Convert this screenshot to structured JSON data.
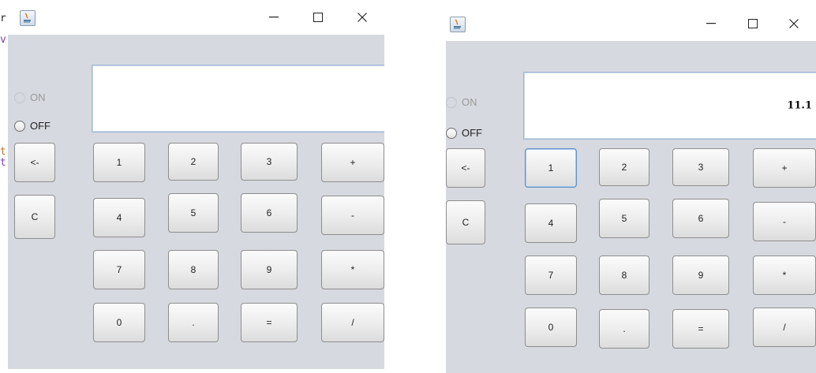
{
  "left_strip": {
    "chars": [
      "r",
      "v",
      "t",
      "t"
    ]
  },
  "window_left": {
    "radio_on": {
      "label": "ON",
      "selected": false,
      "enabled": false
    },
    "radio_off": {
      "label": "OFF",
      "selected": false,
      "enabled": true
    },
    "display_value": "",
    "side_keys": [
      "<-",
      "C"
    ],
    "keys": [
      [
        "1",
        "2",
        "3",
        "+"
      ],
      [
        "4",
        "5",
        "6",
        "-"
      ],
      [
        "7",
        "8",
        "9",
        "*"
      ],
      [
        "0",
        ".",
        "=",
        "/"
      ]
    ]
  },
  "window_right": {
    "radio_on": {
      "label": "ON",
      "selected": false,
      "enabled": false
    },
    "radio_off": {
      "label": "OFF",
      "selected": false,
      "enabled": true
    },
    "display_value": "11.1",
    "side_keys": [
      "<-",
      "C"
    ],
    "keys": [
      [
        "1",
        "2",
        "3",
        "+"
      ],
      [
        "4",
        "5",
        "6",
        "-"
      ],
      [
        "7",
        "8",
        "9",
        "*"
      ],
      [
        "0",
        ".",
        "=",
        "/"
      ]
    ],
    "focused_key": "1"
  },
  "colors": {
    "content_bg": "#d6d9df",
    "display_border": "#9fb6d3",
    "focus_border": "#5f8fc6",
    "strip_text": "#7a3fb0",
    "strip_text_2": "#c0782a"
  }
}
